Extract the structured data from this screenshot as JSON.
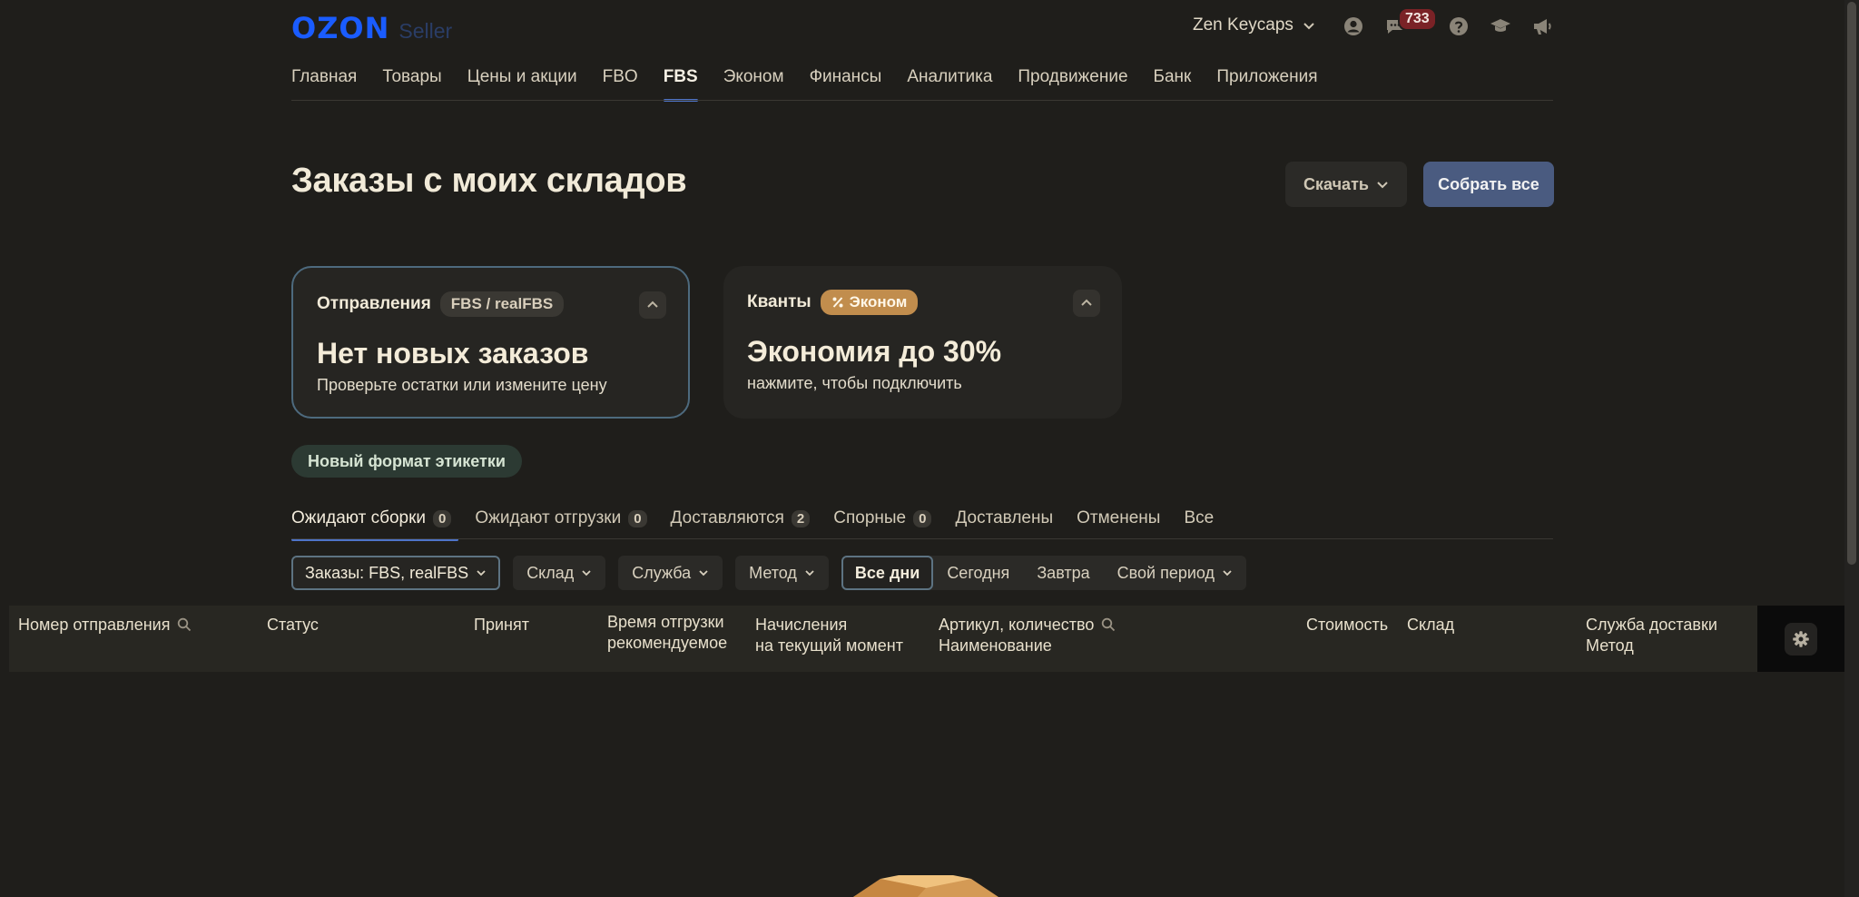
{
  "header": {
    "logo_text": "OZON",
    "logo_sub": "Seller",
    "account_name": "Zen Keycaps",
    "notifications_count": "733",
    "icons": [
      "profile-icon",
      "chat-icon",
      "help-icon",
      "education-icon",
      "megaphone-icon"
    ]
  },
  "nav": {
    "items": [
      "Главная",
      "Товары",
      "Цены и акции",
      "FBO",
      "FBS",
      "Эконом",
      "Финансы",
      "Аналитика",
      "Продвижение",
      "Банк",
      "Приложения"
    ],
    "active": "FBS"
  },
  "page": {
    "title": "Заказы с моих складов",
    "download_label": "Скачать",
    "collect_label": "Собрать все"
  },
  "cards": {
    "shipments": {
      "label": "Отправления",
      "chip": "FBS / realFBS",
      "title": "Нет новых заказов",
      "subtitle": "Проверьте остатки или измените цену"
    },
    "quanta": {
      "label": "Кванты",
      "chip": "Эконом",
      "title": "Экономия до 30%",
      "subtitle": "нажмите, чтобы подключить"
    }
  },
  "label_pill": "Новый формат этикетки",
  "tabs": [
    {
      "label": "Ожидают сборки",
      "count": "0"
    },
    {
      "label": "Ожидают отгрузки",
      "count": "0"
    },
    {
      "label": "Доставляются",
      "count": "2"
    },
    {
      "label": "Спорные",
      "count": "0"
    },
    {
      "label": "Доставлены"
    },
    {
      "label": "Отменены"
    },
    {
      "label": "Все"
    }
  ],
  "filters": {
    "orders": "Заказы: FBS, realFBS",
    "warehouse": "Склад",
    "service": "Служба",
    "method": "Метод",
    "period": {
      "all_days": "Все дни",
      "today": "Сегодня",
      "tomorrow": "Завтра",
      "custom": "Свой период"
    }
  },
  "table": {
    "columns": {
      "shipment_number": "Номер отправления",
      "status": "Статус",
      "accepted": "Принят",
      "ship_time_1": "Время отгрузки",
      "ship_time_2": "рекомендуемое",
      "accruals_1": "Начисления",
      "accruals_2": "на текущий момент",
      "article_1": "Артикул, количество",
      "article_2": "Наименование",
      "cost": "Стоимость",
      "warehouse": "Склад",
      "delivery_1": "Служба доставки",
      "delivery_2": "Метод"
    }
  },
  "colors": {
    "background": "#1f1e1b",
    "accent": "#4e74c9",
    "logo": "#1a5cff",
    "primary_button": "#4a5b80",
    "econom_chip": "#c18d4d",
    "badge": "#7a2226"
  }
}
